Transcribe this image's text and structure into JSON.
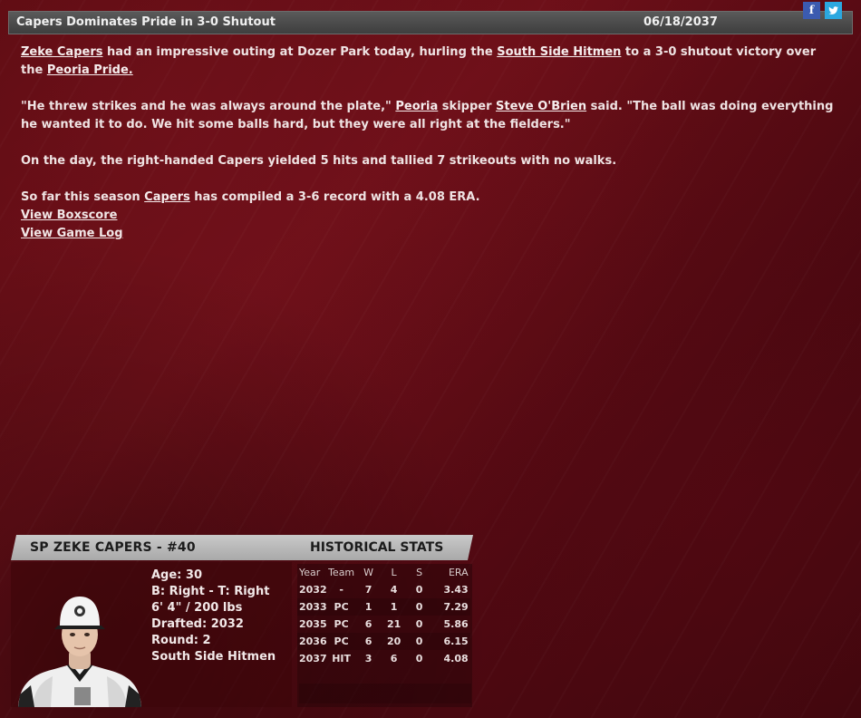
{
  "header": {
    "title": "Capers Dominates Pride in 3-0 Shutout",
    "date": "06/18/2037",
    "facebook_glyph": "f",
    "twitter_glyph": "t",
    "colors": {
      "bar": "#4a4a4a",
      "facebook": "#3b5bb0",
      "twitter": "#2ba8e0"
    }
  },
  "story": {
    "p1": {
      "player": "Zeke Capers",
      "t1": " had an impressive outing at Dozer Park today, hurling the ",
      "team": "South Side Hitmen",
      "t2": " to a 3-0 shutout victory over the ",
      "opponent": "Peoria Pride."
    },
    "p2": {
      "t1": "\"He threw strikes and he was always around the plate,\" ",
      "city": "Peoria",
      "t2": " skipper ",
      "manager": "Steve O'Brien",
      "t3": " said. \"The ball was doing everything he wanted it to do. We hit some balls hard, but they were all right at the fielders.\""
    },
    "p3": "On the day, the right-handed Capers yielded 5 hits and tallied 7 strikeouts with no walks.",
    "p4": {
      "t1": "So far this season ",
      "player": "Capers",
      "t2": " has compiled a 3-6 record with a 4.08 ERA."
    },
    "links": {
      "boxscore": "View Boxscore",
      "gamelog": "View Game Log"
    }
  },
  "player_card": {
    "name": "SP ZEKE CAPERS - #40",
    "stats_title": "HISTORICAL STATS",
    "bio": {
      "age": "Age: 30",
      "bats_throws": "B: Right - T: Right",
      "height_weight": "6' 4\" / 200 lbs",
      "drafted": "Drafted: 2032",
      "round": "Round: 2",
      "team": "South Side Hitmen"
    },
    "stats": {
      "headers": [
        "Year",
        "Team",
        "W",
        "L",
        "S",
        "ERA"
      ],
      "rows": [
        [
          "2032",
          "-",
          "7",
          "4",
          "0",
          "3.43"
        ],
        [
          "2033",
          "PC",
          "1",
          "1",
          "0",
          "7.29"
        ],
        [
          "2035",
          "PC",
          "6",
          "21",
          "0",
          "5.86"
        ],
        [
          "2036",
          "PC",
          "6",
          "20",
          "0",
          "6.15"
        ],
        [
          "2037",
          "HIT",
          "3",
          "6",
          "0",
          "4.08"
        ]
      ]
    }
  }
}
